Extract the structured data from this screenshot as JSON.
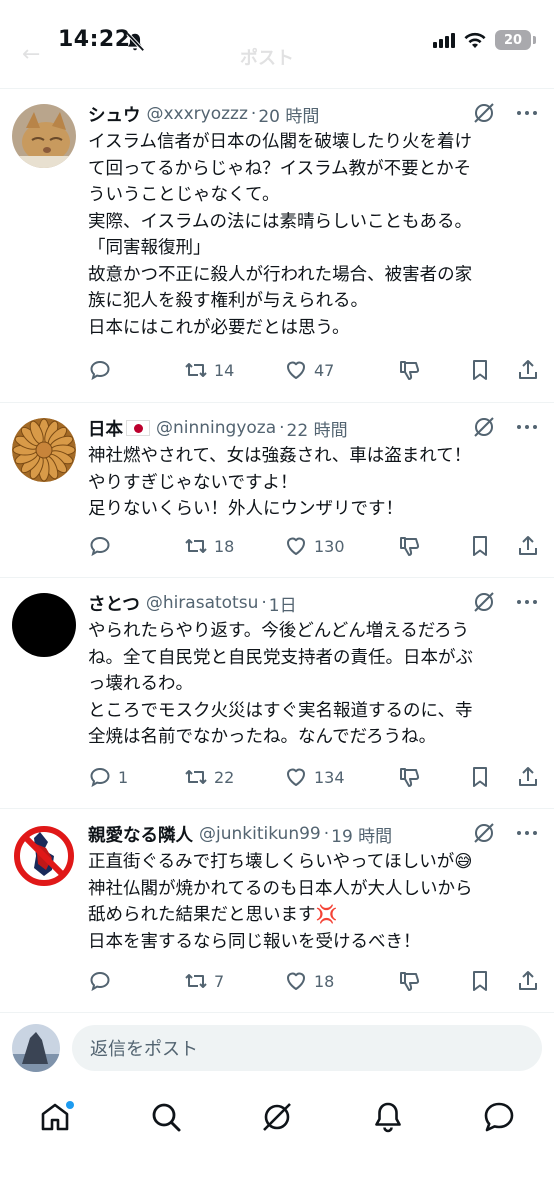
{
  "status": {
    "time": "14:22",
    "battery": "20"
  },
  "header": {
    "title": "ポスト",
    "back": "←"
  },
  "tweets": [
    {
      "name": "シュウ",
      "handle": "@xxxryozzz",
      "sep": "·",
      "time": "20 時間",
      "lines": [
        "イスラム信者が日本の仏閣を破壊したり火を着け",
        "て回ってるからじゃね？イスラム教が不要とかそ",
        "ういうことじゃなくて。",
        "実際、イスラムの法には素晴らしいこともある。",
        "「同害報復刑」",
        "故意かつ不正に殺人が行われた場合、被害者の家",
        "族に犯人を殺す権利が与えられる。",
        "日本にはこれが必要だとは思う。"
      ],
      "replies": "",
      "reposts": "14",
      "likes": "47"
    },
    {
      "name": "日本",
      "handle": "@ninningyoza",
      "sep": "·",
      "time": "22 時間",
      "lines": [
        "神社燃やされて、女は強姦され、車は盗まれて！",
        "やりすぎじゃないですよ！",
        "足りないくらい！外人にウンザリです！"
      ],
      "replies": "",
      "reposts": "18",
      "likes": "130"
    },
    {
      "name": "さとつ",
      "handle": "@hirasatotsu",
      "sep": "·",
      "time": "1日",
      "lines": [
        "やられたらやり返す。今後どんどん増えるだろう",
        "ね。全て自民党と自民党支持者の責任。日本がぶ",
        "っ壊れるわ。",
        "ところでモスク火災はすぐ実名報道するのに、寺",
        "全焼は名前でなかったね。なんでだろうね。"
      ],
      "replies": "1",
      "reposts": "22",
      "likes": "134"
    },
    {
      "name": "親愛なる隣人",
      "handle": "@junkitikun99",
      "sep": "·",
      "time": "19 時間",
      "lines": [
        "正直街ぐるみで打ち壊しくらいやってほしいが😅",
        "神社仏閣が焼かれてるのも日本人が大人しいから",
        "舐められた結果だと思います💢",
        "日本を害するなら同じ報いを受けるべき！"
      ],
      "replies": "",
      "reposts": "7",
      "likes": "18"
    }
  ],
  "reply": {
    "placeholder": "返信をポスト"
  },
  "colors": {
    "text": "#0f1419",
    "secondary": "#536471",
    "accent": "#1d9bf0",
    "divider": "#eff3f4"
  },
  "icons": [
    "reply-icon",
    "repost-icon",
    "like-icon",
    "dislike-icon",
    "bookmark-icon",
    "share-icon",
    "grok-icon",
    "more-icon",
    "home-icon",
    "search-icon",
    "notifications-icon",
    "messages-icon"
  ]
}
